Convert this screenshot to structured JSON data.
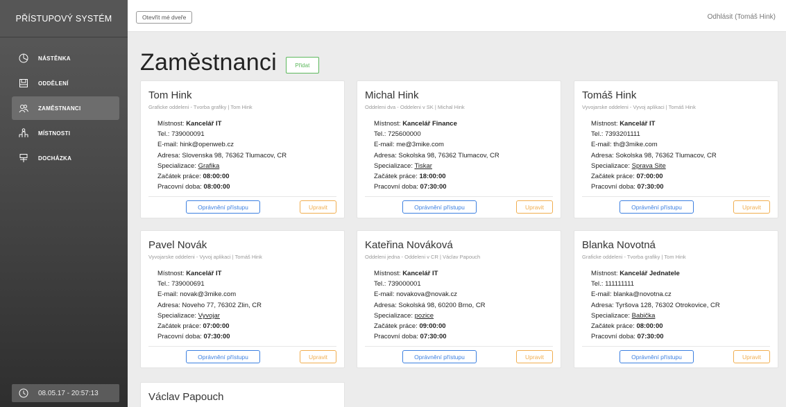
{
  "sidebar": {
    "brand": "PŘÍSTUPOVÝ SYSTÉM",
    "items": [
      {
        "label": "NÁSTĚNKA",
        "icon": "dashboard-icon"
      },
      {
        "label": "ODDĚLENÍ",
        "icon": "department-icon"
      },
      {
        "label": "ZAMĚSTNANCI",
        "icon": "employees-icon",
        "active": true
      },
      {
        "label": "MÍSTNOSTI",
        "icon": "rooms-icon"
      },
      {
        "label": "DOCHÁZKA",
        "icon": "attendance-icon"
      }
    ],
    "clock": "08.05.17 - 20:57:13"
  },
  "topbar": {
    "open_doors": "Otevřít mé dveře",
    "logout": "Odhlásit (Tomáš Hink)"
  },
  "main": {
    "title": "Zaměstnanci",
    "add_label": "Přidat"
  },
  "labels": {
    "room": "Místnost: ",
    "phone": "Tel.: ",
    "email": "E-mail: ",
    "address": "Adresa: ",
    "specialization": "Specializace: ",
    "start": "Začátek práce: ",
    "hours": "Pracovní doba: ",
    "access_button": "Oprávnění přístupu",
    "edit_button": "Upravit"
  },
  "employees": [
    {
      "name": "Tom Hink",
      "sub": "Graficke oddeleni - Tvorba grafiky | Tom Hink",
      "room": "Kancelář IT",
      "phone": "739000091",
      "email": "hink@openweb.cz",
      "address": "Slovenska 98, 76362 Tlumacov, CR",
      "specialization": "Grafika",
      "start": "08:00:00",
      "hours": "08:00:00"
    },
    {
      "name": "Michal Hink",
      "sub": "Oddeleni dva - Oddeleni v SK | Michal Hink",
      "room": "Kancelář Finance",
      "phone": "725600000",
      "email": "me@3mike.com",
      "address": "Sokolska 98, 76362 Tlumacov, CR",
      "specialization": "Tiskar",
      "start": "18:00:00",
      "hours": "07:30:00"
    },
    {
      "name": "Tomáš Hink",
      "sub": "Vyvojarske oddeleni - Vyvoj aplikaci | Tomáš Hink",
      "room": "Kancelář IT",
      "phone": "7393201111",
      "email": "th@3mike.com",
      "address": "Sokolska 98, 76362 Tlumacov, CR",
      "specialization": "Sprava Site",
      "start": "07:00:00",
      "hours": "07:30:00"
    },
    {
      "name": "Pavel Novák",
      "sub": "Vyvojarske oddeleni - Vyvoj aplikaci | Tomáš Hink",
      "room": "Kancelář IT",
      "phone": "739000691",
      "email": "novak@3mike.com",
      "address": "Noveho 77, 76302 Zlin, CR",
      "specialization": "Vyvojar",
      "start": "07:00:00",
      "hours": "07:30:00"
    },
    {
      "name": "Kateřina Nováková",
      "sub": "Oddeleni jedna - Oddeleni v CR | Václav Papouch",
      "room": "Kancelář IT",
      "phone": "739000001",
      "email": "novakova@novak.cz",
      "address": "Sokolská 98, 60200 Brno, CR",
      "specialization": "pozice",
      "start": "09:00:00",
      "hours": "07:30:00"
    },
    {
      "name": "Blanka Novotná",
      "sub": "Graficke oddeleni - Tvorba grafiky | Tom Hink",
      "room": "Kancelář Jednatele",
      "phone": "111111111",
      "email": "blanka@novotna.cz",
      "address": "Tyršova 128, 76302 Otrokovice, CR",
      "specialization": "Babička",
      "start": "08:00:00",
      "hours": "07:30:00"
    },
    {
      "name": "Václav Papouch",
      "sub": "",
      "room": "",
      "phone": "",
      "email": "",
      "address": "",
      "specialization": "",
      "start": "",
      "hours": ""
    }
  ]
}
